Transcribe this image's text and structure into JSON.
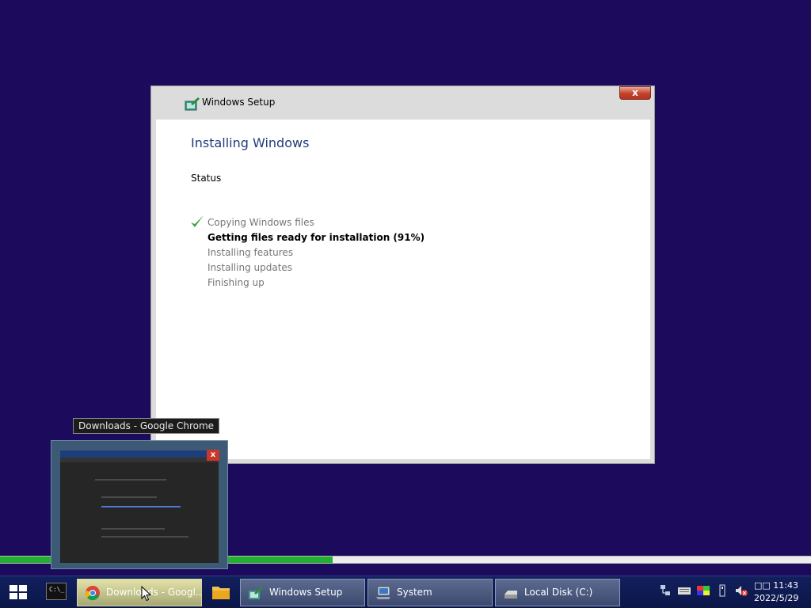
{
  "setup_window": {
    "title": "Windows Setup",
    "close_label": "x",
    "heading": "Installing Windows",
    "status_label": "Status",
    "steps": [
      {
        "label": "Copying Windows files",
        "state": "done"
      },
      {
        "label": "Getting files ready for installation (91%)",
        "state": "active"
      },
      {
        "label": "Installing features",
        "state": "pending"
      },
      {
        "label": "Installing updates",
        "state": "pending"
      },
      {
        "label": "Finishing up",
        "state": "pending"
      }
    ]
  },
  "progress": {
    "fraction": 0.41,
    "color": "#22b030"
  },
  "tooltip": {
    "text": "Downloads - Google Chrome"
  },
  "preview": {
    "close_label": "x"
  },
  "taskbar": {
    "items": [
      {
        "label": "Downloads - Googl...",
        "icon": "chrome-icon",
        "active": true
      },
      {
        "label": "Windows Setup",
        "icon": "setup-icon",
        "active": false
      },
      {
        "label": "System",
        "icon": "computer-icon",
        "active": false
      },
      {
        "label": "Local Disk (C:)",
        "icon": "drive-icon",
        "active": false
      }
    ],
    "clock_line1": "□□ 11:43",
    "clock_date": "2022/5/29",
    "tray_icons": [
      "network-icon",
      "keyboard-icon",
      "color-icon",
      "usb-icon",
      "volume-muted-icon"
    ]
  },
  "colors": {
    "desktop": "#1c0a5c",
    "heading": "#1f3c7a",
    "taskbar": "#0b1648"
  }
}
